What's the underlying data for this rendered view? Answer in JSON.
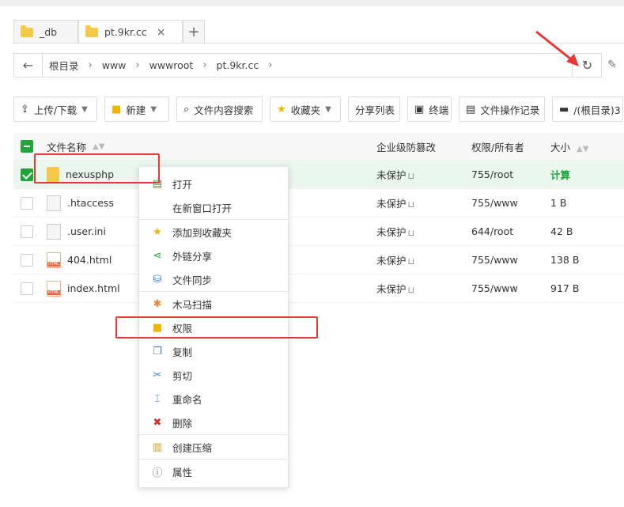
{
  "tabs": [
    {
      "label": "_db"
    },
    {
      "label": "pt.9kr.cc",
      "close": "×"
    },
    {
      "label": "+"
    }
  ],
  "path": {
    "back": "←",
    "crumbs": [
      "根目录",
      "www",
      "wwwroot",
      "pt.9kr.cc"
    ],
    "sep": "›",
    "refresh": "↻"
  },
  "toolbar": {
    "upload": "上传/下载",
    "new": "新建",
    "search": "文件内容搜索",
    "favorites": "收藏夹",
    "share_list": "分享列表",
    "terminal": "终端",
    "op_log": "文件操作记录",
    "disk": "/(根目录)3"
  },
  "table": {
    "headers": {
      "name": "文件名称",
      "protect": "企业级防篡改",
      "perm": "权限/所有者",
      "size": "大小"
    },
    "rows": [
      {
        "name": "nexusphp",
        "type": "folder",
        "protect": "未保护",
        "perm": "755/root",
        "size": "计算",
        "selected": true
      },
      {
        "name": ".htaccess",
        "type": "doc",
        "protect": "未保护",
        "perm": "755/www",
        "size": "1 B"
      },
      {
        "name": ".user.ini",
        "type": "doc",
        "protect": "未保护",
        "perm": "644/root",
        "size": "42 B"
      },
      {
        "name": "404.html",
        "type": "html",
        "protect": "未保护",
        "perm": "755/www",
        "size": "138 B"
      },
      {
        "name": "index.html",
        "type": "html",
        "protect": "未保护",
        "perm": "755/www",
        "size": "917 B"
      }
    ]
  },
  "context_menu": [
    {
      "label": "打开",
      "icon": "open-icon"
    },
    {
      "label": "在新窗口打开",
      "icon": ""
    },
    {
      "label": "添加到收藏夹",
      "icon": "star-icon"
    },
    {
      "label": "外链分享",
      "icon": "share-icon"
    },
    {
      "label": "文件同步",
      "icon": "sync-icon"
    },
    {
      "label": "木马扫描",
      "icon": "scan-icon"
    },
    {
      "label": "权限",
      "icon": "permission-icon"
    },
    {
      "label": "复制",
      "icon": "copy-icon"
    },
    {
      "label": "剪切",
      "icon": "scissors-icon"
    },
    {
      "label": "重命名",
      "icon": "rename-icon"
    },
    {
      "label": "删除",
      "icon": "delete-icon"
    },
    {
      "label": "创建压缩",
      "icon": "zip-icon"
    },
    {
      "label": "属性",
      "icon": "info-icon"
    }
  ],
  "colors": {
    "accent": "#20a53a",
    "highlight": "#e53935"
  }
}
